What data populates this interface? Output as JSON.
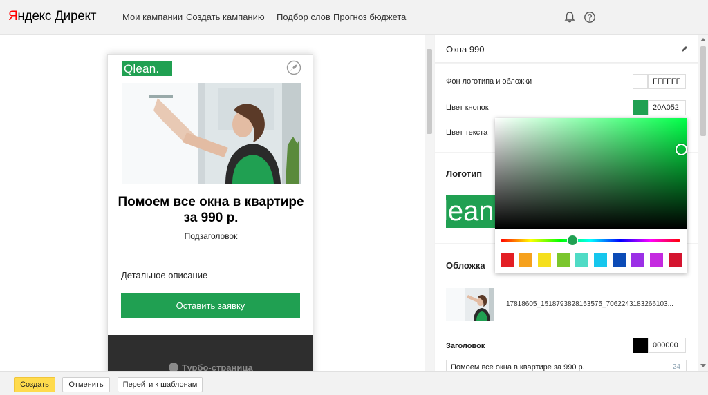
{
  "app": {
    "logo_red": "Я",
    "logo_rest": "ндекс Директ"
  },
  "nav": [
    "Мои кампании",
    "Создать кампанию",
    "Подбор слов",
    "Прогноз бюджета"
  ],
  "top_icons": [
    "bell-icon",
    "help-icon"
  ],
  "ad": {
    "brand": "Qlean.",
    "title": "Помоем все окна в квартире за 990 р.",
    "subtitle": "Подзаголовок",
    "description": "Детальное описание",
    "cta": "Оставить заявку",
    "footer": "Турбо-страница"
  },
  "panel": {
    "title": "Окна 990",
    "bg_label": "Фон логотипа и обложки",
    "bg_color": "FFFFFF",
    "button_label": "Цвет кнопок",
    "button_color": "20A052",
    "text_label": "Цвет текста",
    "logo_header": "Логотип",
    "cover_header": "Обложка",
    "cover_file": "17818605_1518793828153575_7062243183266103...",
    "heading_label": "Заголовок",
    "heading_color": "000000",
    "heading_value": "Помоем все окна в квартире за 990 р.",
    "heading_counter": "24"
  },
  "picker": {
    "presets": [
      "#e31e24",
      "#f6a11c",
      "#f5df1c",
      "#7bc62d",
      "#4fdbc5",
      "#16c6ed",
      "#0c4bb6",
      "#9b2fe6",
      "#c52ae0",
      "#d4142f"
    ]
  },
  "colors": {
    "accent": "#20A052",
    "yellow": "#ffdb4d"
  },
  "bottom": {
    "create": "Создать",
    "cancel": "Отменить",
    "templates": "Перейти к шаблонам"
  }
}
